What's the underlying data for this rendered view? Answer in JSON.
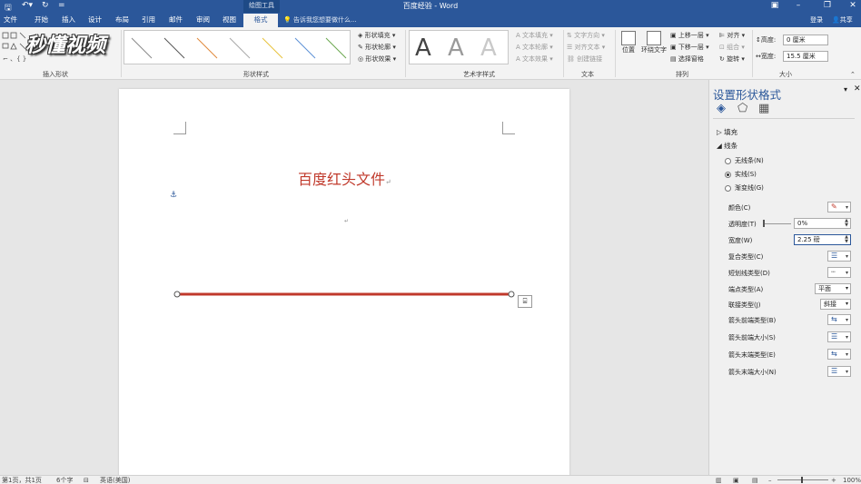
{
  "title_bar": {
    "context_tools": "绘图工具",
    "document_title": "百度经验 - Word"
  },
  "tabs": [
    "文件",
    "开始",
    "插入",
    "设计",
    "布局",
    "引用",
    "邮件",
    "审阅",
    "视图"
  ],
  "active_tab": "格式",
  "tell_me": "告诉我您想要做什么...",
  "account": {
    "login": "登录",
    "share": "共享"
  },
  "ribbon": {
    "groups": {
      "insert_shapes": "插入形状",
      "shape_styles": "形状样式",
      "art_styles": "艺术字样式",
      "text": "文本",
      "arrange": "排列",
      "size": "大小"
    },
    "shape_fill": "形状填充",
    "shape_outline": "形状轮廓",
    "shape_effects": "形状效果",
    "text_fill": "文本填充",
    "text_outline": "文本轮廓",
    "text_effects": "文本效果",
    "text_direction": "文字方向",
    "align_text": "对齐文本",
    "create_link": "创建链接",
    "position": "位置",
    "wrap_text": "环绕文字",
    "bring_forward": "上移一层",
    "send_backward": "下移一层",
    "selection_pane": "选择窗格",
    "align": "对齐",
    "group": "组合",
    "rotate": "旋转",
    "height_label": "高度:",
    "height_value": "0 厘米",
    "width_label": "宽度:",
    "width_value": "15.5 厘米",
    "art_letter": "A"
  },
  "watermark": "秒懂视频",
  "document": {
    "heading": "百度红头文件",
    "line_color": "#c0392b"
  },
  "pane": {
    "title": "设置形状格式",
    "fill_section": "填充",
    "line_section": "线条",
    "options": {
      "no_line": "无线条(N)",
      "solid_line": "实线(S)",
      "gradient_line": "渐变线(G)"
    },
    "properties": {
      "color": "颜色(C)",
      "transparency": "透明度(T)",
      "transparency_value": "0%",
      "width": "宽度(W)",
      "width_value": "2.25 磅",
      "compound_type": "复合类型(C)",
      "dash_type": "短划线类型(D)",
      "cap_type": "端点类型(A)",
      "cap_value": "平面",
      "join_type": "联接类型(J)",
      "join_value": "斜接",
      "begin_arrow_type": "箭头前端类型(B)",
      "begin_arrow_size": "箭头前端大小(S)",
      "end_arrow_type": "箭头末端类型(E)",
      "end_arrow_size": "箭头末端大小(N)"
    }
  },
  "status_bar": {
    "page": "第1页，共1页",
    "words": "6个字",
    "language": "英语(美国)",
    "zoom": "100%"
  }
}
